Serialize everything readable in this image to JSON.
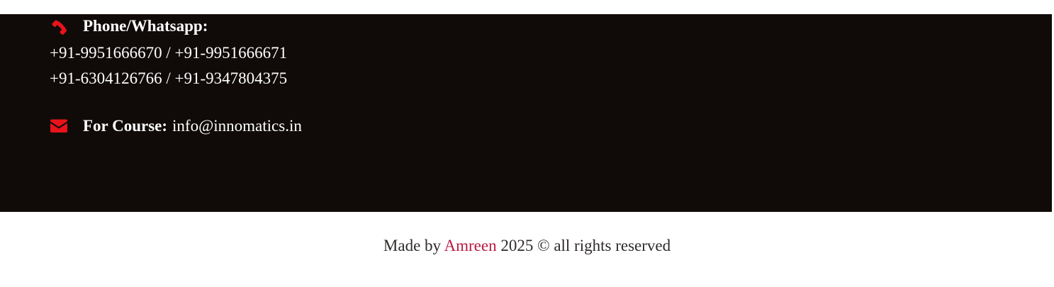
{
  "contact": {
    "phone_icon": "phone-icon",
    "phone_heading": "Phone/Whatsapp:",
    "phone_line_1": "+91-9951666670 / +91-9951666671",
    "phone_line_2": "+91-6304126766 / +91-9347804375",
    "mail_icon": "envelope-icon",
    "course_heading": "For Course:",
    "course_email": "info@innomatics.in"
  },
  "footer": {
    "prefix": "Made by",
    "author": "Amreen",
    "suffix": "2025 © all rights reserved"
  },
  "colors": {
    "panel_background": "#100b09",
    "icon_red": "#e8131b",
    "author_link": "#b8183f",
    "footer_text": "#2f2a2a"
  }
}
